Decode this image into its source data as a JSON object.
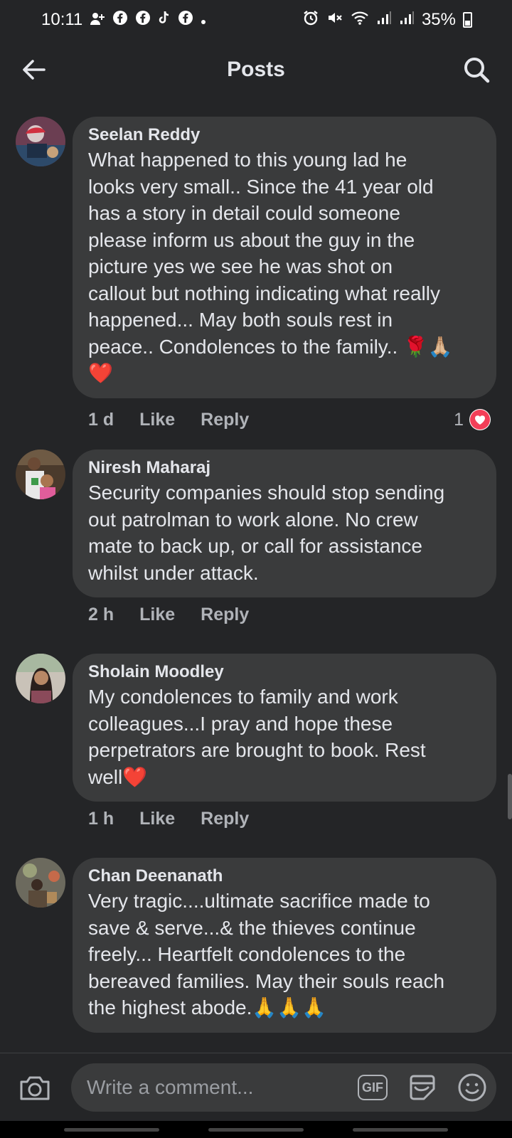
{
  "status_bar": {
    "time": "10:11",
    "battery": "35%",
    "left_icons": [
      "person-add-icon",
      "facebook-icon",
      "facebook-icon",
      "tiktok-icon",
      "facebook-icon",
      "dot-icon"
    ],
    "right_icons": [
      "alarm-icon",
      "mute-icon",
      "wifi-icon",
      "signal-icon",
      "signal-icon",
      "battery-icon"
    ]
  },
  "header": {
    "title": "Posts",
    "back_icon": "back-arrow-icon",
    "search_icon": "search-icon"
  },
  "comments": [
    {
      "author": "Seelan Reddy",
      "text": "What happened to this young lad he\nlooks very small.. Since the 41 year old\nhas a story in detail could someone\nplease inform us about the guy in the\npicture yes we see he was shot on\ncallout but nothing indicating what really\nhappened... May both souls rest in\npeace.. Condolences to the family.. 🌹🙏🏼\n❤️",
      "time": "1 d",
      "like": "Like",
      "reply": "Reply",
      "reaction_count": "1"
    },
    {
      "author": "Niresh Maharaj",
      "text": "Security companies should stop sending\nout patrolman to work alone. No crew\nmate to back up, or call for assistance\nwhilst under attack.",
      "time": "2 h",
      "like": "Like",
      "reply": "Reply"
    },
    {
      "author": "Sholain Moodley",
      "text": "My condolences to family and work\ncolleagues...I pray and hope these\nperpetrators are brought to book. Rest\nwell❤️",
      "time": "1 h",
      "like": "Like",
      "reply": "Reply"
    },
    {
      "author": "Chan Deenanath",
      "text": "Very tragic....ultimate sacrifice made to\nsave & serve...& the thieves continue\nfreely... Heartfelt condolences to the\nbereaved families. May their souls reach\nthe highest abode.🙏🙏🙏"
    }
  ],
  "composer": {
    "placeholder": "Write a comment...",
    "gif_label": "GIF",
    "camera_icon": "camera-icon",
    "sticker_icon": "sticker-icon",
    "emoji_icon": "emoji-icon"
  },
  "colors": {
    "background": "#242527",
    "bubble": "#3a3b3c",
    "text_primary": "#e4e6eb",
    "text_secondary": "#b0b3b8",
    "heart": "#f33e58"
  }
}
